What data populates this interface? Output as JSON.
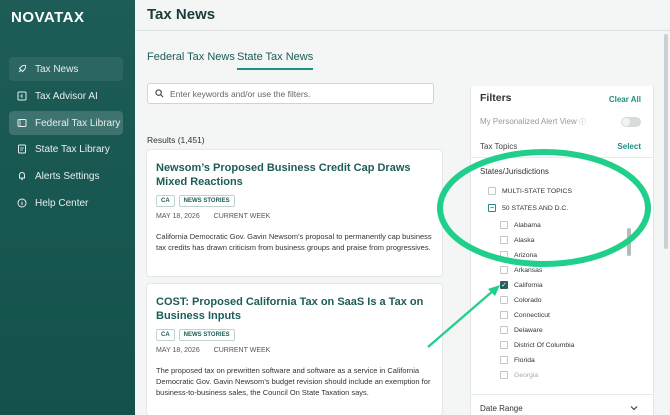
{
  "brand": {
    "logo": "NOVATAX"
  },
  "sidebar": {
    "items": [
      {
        "label": "Tax News",
        "icon": "rocket-icon"
      },
      {
        "label": "Tax Advisor AI",
        "icon": "ai-chat-icon"
      },
      {
        "label": "Federal Tax Library",
        "icon": "book-icon"
      },
      {
        "label": "State Tax Library",
        "icon": "document-icon"
      },
      {
        "label": "Alerts Settings",
        "icon": "bell-icon"
      },
      {
        "label": "Help Center",
        "icon": "help-icon"
      }
    ]
  },
  "header": {
    "title": "Tax News"
  },
  "tabs": [
    {
      "label": "Federal Tax News"
    },
    {
      "label": "State Tax News"
    }
  ],
  "search": {
    "placeholder": "Enter keywords and/or use the filters."
  },
  "results": {
    "count_text": "Results (1,451)"
  },
  "articles": [
    {
      "title": "Newsom’s Proposed Business Credit Cap Draws Mixed Reactions",
      "badges": [
        "CA",
        "NEWS STORIES"
      ],
      "date": "MAY 18, 2026",
      "period": "CURRENT WEEK",
      "description": "California Democratic Gov. Gavin Newsom’s proposal to permanently cap business tax credits has drawn criticism from business groups and praise from progressives."
    },
    {
      "title": "COST: Proposed California Tax on SaaS Is a Tax on Business Inputs",
      "badges": [
        "CA",
        "NEWS STORIES"
      ],
      "date": "MAY 18, 2026",
      "period": "CURRENT WEEK",
      "description": "The proposed tax on prewritten software and software as a service in California Democratic Gov. Gavin Newsom’s budget revision should include an exemption for business-to-business sales, the Council On State Taxation says."
    }
  ],
  "filters": {
    "title": "Filters",
    "clear_all": "Clear All",
    "personalized": "My Personalized Alert View",
    "personalized_enabled": false,
    "tax_topics": "Tax Topics",
    "select": "Select",
    "states_label": "States/Jurisdictions",
    "multi_state": "MULTI-STATE TOPICS",
    "fifty_states": "50 STATES AND D.C.",
    "states": [
      {
        "name": "Alabama",
        "checked": false
      },
      {
        "name": "Alaska",
        "checked": false
      },
      {
        "name": "Arizona",
        "checked": false
      },
      {
        "name": "Arkansas",
        "checked": false
      },
      {
        "name": "California",
        "checked": true
      },
      {
        "name": "Colorado",
        "checked": false
      },
      {
        "name": "Connecticut",
        "checked": false
      },
      {
        "name": "Delaware",
        "checked": false
      },
      {
        "name": "District Of Columbia",
        "checked": false
      },
      {
        "name": "Florida",
        "checked": false
      },
      {
        "name": "Georgia",
        "checked": false
      }
    ],
    "date_range": "Date Range"
  },
  "colors": {
    "sidebar": "#1d5c57",
    "accent": "#1d8f84",
    "highlight": "#1fcf8a"
  }
}
